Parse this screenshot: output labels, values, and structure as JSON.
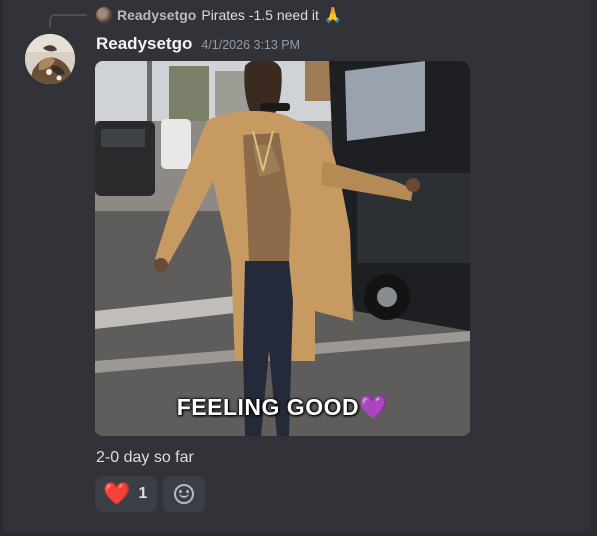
{
  "reply": {
    "author": "Readysetgo",
    "text": "Pirates -1.5 need it",
    "emoji_icon": "pray-icon"
  },
  "message": {
    "author": "Readysetgo",
    "timestamp": "4/1/2026 3:13 PM",
    "gif_caption": "FEELING GOOD",
    "gif_caption_emoji": "💜",
    "text": "2-0 day so far"
  },
  "reactions": [
    {
      "emoji": "❤️",
      "icon": "red-heart-icon",
      "count": "1"
    }
  ],
  "add_reaction_icon": "smile-icon",
  "colors": {
    "background": "#323339",
    "author": "#f2f3f5",
    "timestamp": "#949ba4",
    "reaction_bg": "#3c3e45"
  }
}
